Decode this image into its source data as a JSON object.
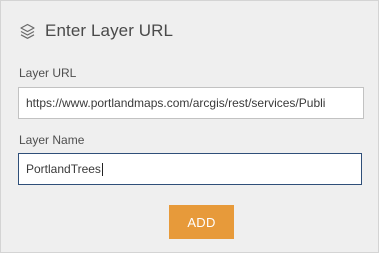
{
  "header": {
    "icon": "layers-icon",
    "title": "Enter Layer URL"
  },
  "form": {
    "url_label": "Layer URL",
    "url_value": "https://www.portlandmaps.com/arcgis/rest/services/Publi",
    "name_label": "Layer Name",
    "name_value": "PortlandTrees",
    "add_label": "ADD"
  },
  "colors": {
    "panel_bg": "#efefef",
    "accent_button": "#e79a3a",
    "focused_border": "#2f4f79"
  }
}
